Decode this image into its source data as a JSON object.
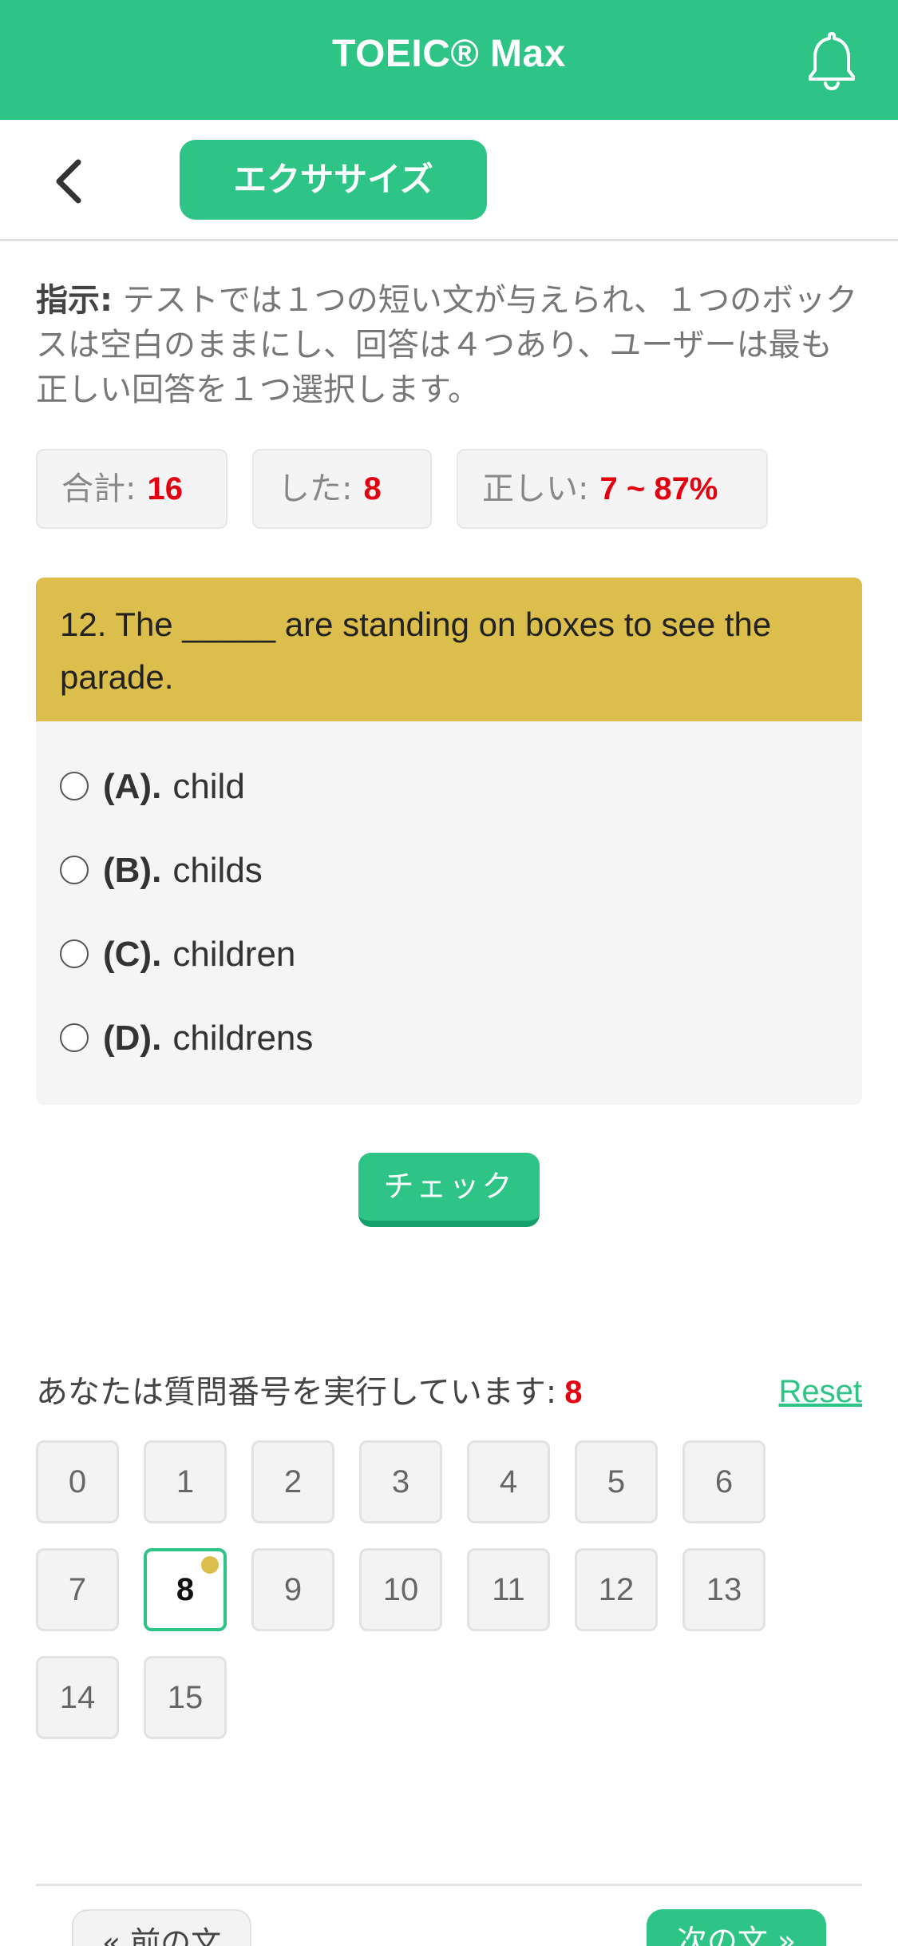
{
  "header": {
    "app_title": "TOEIC® Max",
    "bell_icon": "bell-icon"
  },
  "subbar": {
    "back_icon": "chevron-left-icon",
    "tab_label": "エクササイズ"
  },
  "instruction": {
    "label": "指示:",
    "text": " テストでは１つの短い文が与えられ、１つのボックスは空白のままにし、回答は４つあり、ユーザーは最も正しい回答を１つ選択します。"
  },
  "stats": {
    "total_label": "合計:",
    "total_value": "16",
    "done_label": "した:",
    "done_value": "8",
    "correct_label": "正しい:",
    "correct_value": "7 ~ 87%"
  },
  "question": {
    "text": "12. The _____ are standing on boxes to see the parade.",
    "options": [
      {
        "letter": "(A).",
        "text": "child"
      },
      {
        "letter": "(B).",
        "text": "childs"
      },
      {
        "letter": "(C).",
        "text": "children"
      },
      {
        "letter": "(D).",
        "text": "childrens"
      }
    ]
  },
  "check_button": "チェック",
  "progress": {
    "label": "あなたは質問番号を実行しています:",
    "current": "8",
    "reset_label": "Reset"
  },
  "question_numbers": [
    "0",
    "1",
    "2",
    "3",
    "4",
    "5",
    "6",
    "7",
    "8",
    "9",
    "10",
    "11",
    "12",
    "13",
    "14",
    "15"
  ],
  "active_question_index": 8,
  "footer": {
    "prev_label": "« 前の文",
    "next_label": "次の文 »"
  },
  "colors": {
    "brand_green": "#2ec486",
    "question_header": "#dbbe4c",
    "highlight_red": "#e3000f"
  }
}
